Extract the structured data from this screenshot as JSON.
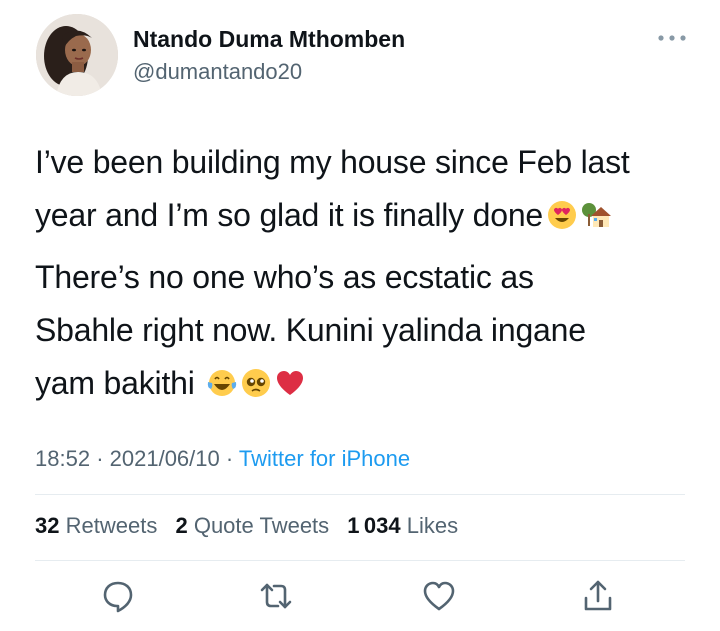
{
  "author": {
    "name": "Ntando Duma Mthomben",
    "handle": "@dumantando20",
    "avatar_icon": "profile-photo"
  },
  "tweet": {
    "paragraph1_part1": "I’ve been building my house since Feb last",
    "paragraph1_part2": "year and I’m so glad it is finally done",
    "paragraph1_emojis": [
      "heart-eyes-emoji",
      "house-with-garden-emoji"
    ],
    "paragraph2_line1": "There’s no one who’s as ecstatic as",
    "paragraph2_line2": "Sbahle right now. Kunini yalinda ingane",
    "paragraph2_line3": "yam bakithi",
    "paragraph2_emojis": [
      "tears-of-joy-emoji",
      "pleading-face-emoji",
      "red-heart-emoji"
    ]
  },
  "meta": {
    "time": "18:52",
    "date": "2021/06/10",
    "source": "Twitter for iPhone",
    "separator": "·"
  },
  "stats": {
    "retweets_count": "32",
    "retweets_label": "Retweets",
    "quotes_count": "2",
    "quotes_label": "Quote Tweets",
    "likes_count": "1 034",
    "likes_label": "Likes"
  },
  "actions": [
    "reply-icon",
    "retweet-icon",
    "like-icon",
    "share-icon"
  ],
  "colors": {
    "text": "#0f1419",
    "secondary": "#536471",
    "link": "#1d9bf0",
    "divider": "#e6ecf0"
  }
}
